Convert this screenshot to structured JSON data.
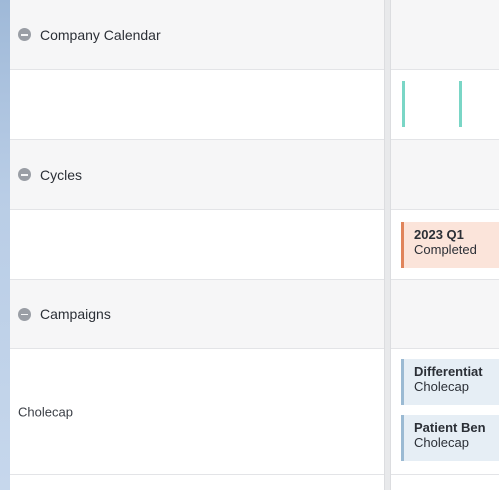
{
  "sections": {
    "company_calendar": {
      "label": "Company Calendar"
    },
    "cycles": {
      "label": "Cycles"
    },
    "campaigns": {
      "label": "Campaigns"
    }
  },
  "rows": {
    "cholecap": {
      "label": "Cholecap"
    }
  },
  "events": {
    "cycle_2023_q1": {
      "title": "2023 Q1",
      "status": "Completed"
    },
    "campaign_1": {
      "title": "Differentiat",
      "product": "Cholecap"
    },
    "campaign_2": {
      "title": "Patient Ben",
      "product": "Cholecap"
    }
  },
  "colors": {
    "cycle_accent": "#e0845b",
    "campaign_accent": "#9bbad3",
    "calendar_marker": "#7ad6c6"
  }
}
